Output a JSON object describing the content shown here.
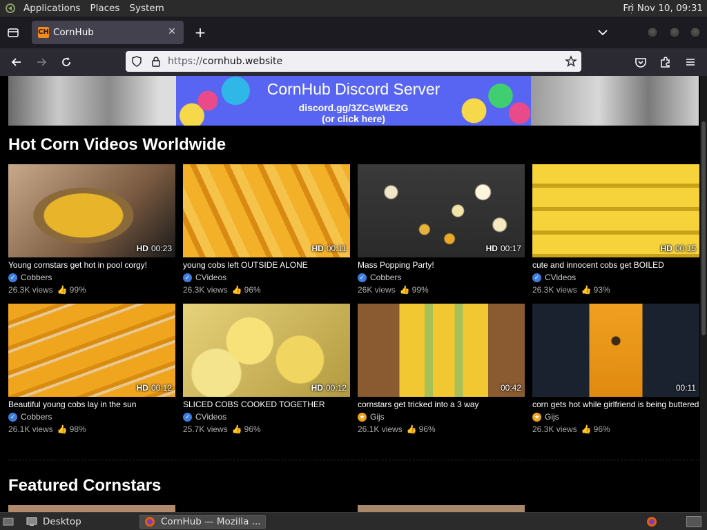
{
  "panel": {
    "menus": [
      "Applications",
      "Places",
      "System"
    ],
    "clock": "Fri Nov 10, 09:31"
  },
  "browser": {
    "tab_title": "CornHub",
    "tab_favicon": "CH",
    "url_protocol": "https://",
    "url_host": "cornhub.website"
  },
  "banner": {
    "line1": "CornHub Discord Server",
    "line2": "discord.gg/3ZCsWkE2G",
    "line3": "(or click here)"
  },
  "sections": {
    "hot": "Hot Corn Videos Worldwide",
    "featured": "Featured Cornstars"
  },
  "videos": [
    {
      "title": "Young cornstars get hot in pool corgy!",
      "hd": "HD",
      "duration": "00:23",
      "channel": "Cobbers",
      "badge": "verified",
      "views": "26.3K views",
      "rating": "99%"
    },
    {
      "title": "young cobs left OUTSIDE ALONE",
      "hd": "HD",
      "duration": "00:11",
      "channel": "CVideos",
      "badge": "verified",
      "views": "26.3K views",
      "rating": "96%"
    },
    {
      "title": "Mass Popping Party!",
      "hd": "HD",
      "duration": "00:17",
      "channel": "Cobbers",
      "badge": "verified",
      "views": "26K views",
      "rating": "99%"
    },
    {
      "title": "cute and innocent cobs get BOILED",
      "hd": "HD",
      "duration": "00:15",
      "channel": "CVideos",
      "badge": "verified",
      "views": "26.3K views",
      "rating": "93%"
    },
    {
      "title": "Beautiful young cobs lay in the sun",
      "hd": "HD",
      "duration": "00:12",
      "channel": "Cobbers",
      "badge": "verified",
      "views": "26.1K views",
      "rating": "98%"
    },
    {
      "title": "SLICED COBS COOKED TOGETHER",
      "hd": "HD",
      "duration": "00:12",
      "channel": "CVideos",
      "badge": "verified",
      "views": "25.7K views",
      "rating": "96%"
    },
    {
      "title": "cornstars get tricked into a 3 way",
      "hd": "",
      "duration": "00:42",
      "channel": "Gijs",
      "badge": "model",
      "views": "26.1K views",
      "rating": "96%"
    },
    {
      "title": "corn gets hot while girlfriend is being buttered",
      "hd": "",
      "duration": "00:11",
      "channel": "Gijs",
      "badge": "model",
      "views": "26.3K views",
      "rating": "96%"
    }
  ],
  "colors": {
    "verified": "#3d7de0",
    "model": "#f0a21b",
    "discord": "#5765f2"
  },
  "taskbar": {
    "desktop": "Desktop",
    "window": "CornHub — Mozilla ..."
  }
}
